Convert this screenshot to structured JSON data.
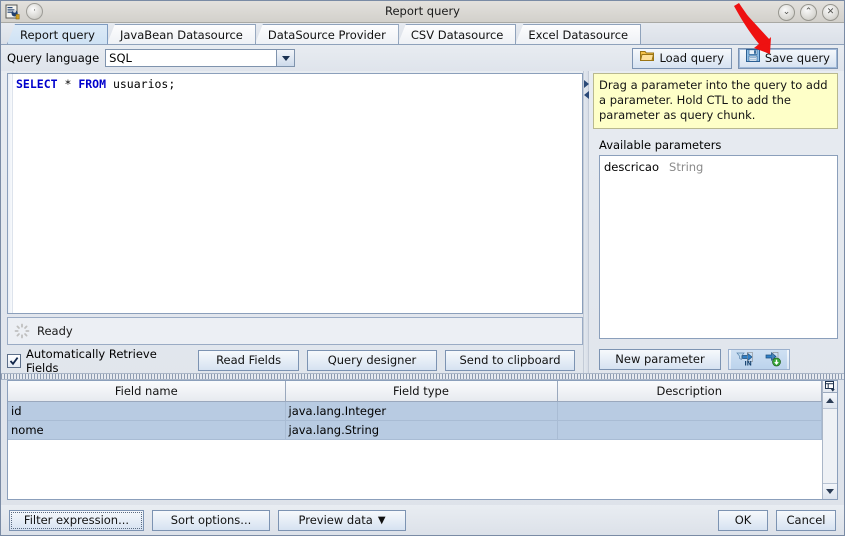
{
  "window": {
    "title": "Report query",
    "app_icon": "report-app-icon",
    "menu_button_icon": "window-menu-icon",
    "controls": [
      {
        "name": "minimize",
        "glyph": "⌄"
      },
      {
        "name": "maximize",
        "glyph": "⌃"
      },
      {
        "name": "close",
        "glyph": "✕"
      }
    ]
  },
  "tabs": [
    {
      "label": "Report query",
      "active": true
    },
    {
      "label": "JavaBean Datasource",
      "active": false
    },
    {
      "label": "DataSource Provider",
      "active": false
    },
    {
      "label": "CSV Datasource",
      "active": false
    },
    {
      "label": "Excel Datasource",
      "active": false
    }
  ],
  "toolbar": {
    "query_language_label": "Query language",
    "query_language_value": "SQL",
    "load_query_label": "Load query",
    "save_query_label": "Save query"
  },
  "editor": {
    "sql_keyword_1": "SELECT",
    "sql_star": " * ",
    "sql_keyword_2": "FROM",
    "sql_table": " usuarios;",
    "full_query": "SELECT * FROM usuarios;"
  },
  "status": {
    "text": "Ready",
    "icon": "spinner-icon"
  },
  "left_controls": {
    "auto_retrieve_label": "Automatically Retrieve Fields",
    "auto_retrieve_checked": true,
    "read_fields_label": "Read Fields",
    "query_designer_label": "Query designer",
    "send_to_clipboard_label": "Send to clipboard"
  },
  "right_panel": {
    "tip_text": "Drag a parameter into the query to add a parameter. Hold CTL to add the parameter as query chunk.",
    "available_parameters_label": "Available parameters",
    "parameters": [
      {
        "name": "descricao",
        "type": "String"
      }
    ],
    "new_parameter_label": "New parameter",
    "icon_buttons": [
      {
        "name": "add-parameter-in-icon"
      },
      {
        "name": "import-parameter-icon"
      }
    ]
  },
  "fields_table": {
    "columns": [
      "Field name",
      "Field type",
      "Description"
    ],
    "rows": [
      {
        "field_name": "id",
        "field_type": "java.lang.Integer",
        "description": ""
      },
      {
        "field_name": "nome",
        "field_type": "java.lang.String",
        "description": ""
      }
    ],
    "column_chooser_icon": "column-chooser-icon"
  },
  "bottom_bar": {
    "filter_expression_label": "Filter expression...",
    "sort_options_label": "Sort options...",
    "preview_data_label": "Preview data",
    "preview_data_arrow": "▼",
    "ok_label": "OK",
    "cancel_label": "Cancel"
  },
  "annotation": {
    "arrow_color": "#ee1111",
    "points_to": "save-query-button"
  }
}
